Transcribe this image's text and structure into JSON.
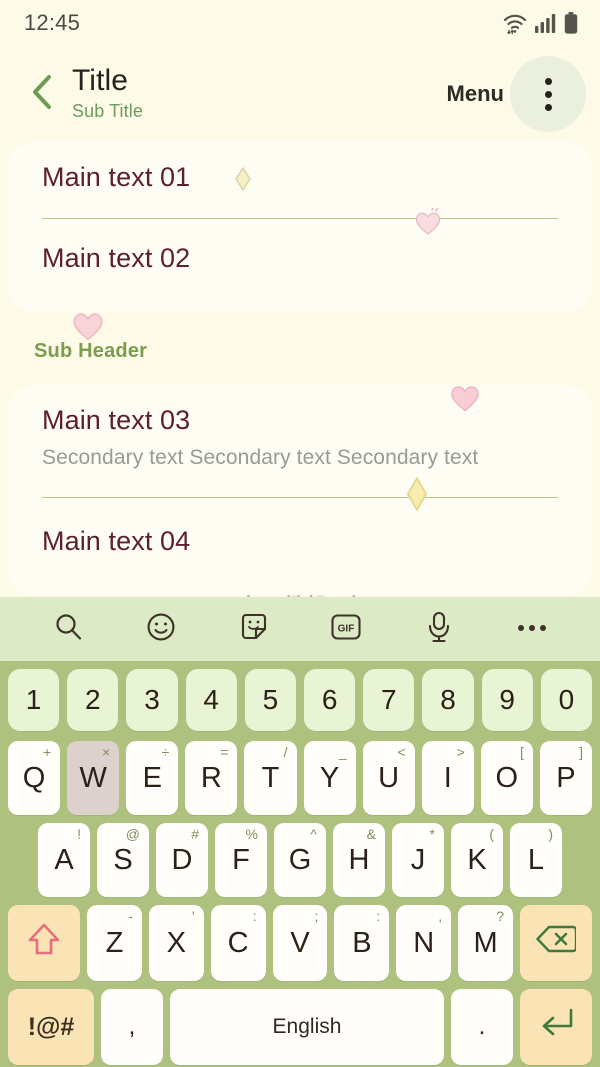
{
  "status_bar": {
    "time": "12:45",
    "icons": [
      "wifi-icon",
      "cellular-signal-icon",
      "battery-icon"
    ]
  },
  "app_bar": {
    "back_icon": "chevron-left-icon",
    "title": "Title",
    "subtitle": "Sub Title",
    "menu_label": "Menu",
    "overflow_icon": "more-vertical-icon"
  },
  "content": {
    "items": [
      {
        "main": "Main text 01",
        "secondary": ""
      },
      {
        "main": "Main text 02",
        "secondary": ""
      }
    ],
    "sub_header": "Sub Header",
    "items2": [
      {
        "main": "Main text 03",
        "secondary": "Secondary text Secondary text Secondary text"
      },
      {
        "main": "Main text 04",
        "secondary": ""
      }
    ],
    "decorations": [
      "diamond-sparkle-icon",
      "heart-icon",
      "heart-icon",
      "heart-icon",
      "diamond-sparkle-icon",
      "turnip-cat-illustration"
    ]
  },
  "keyboard": {
    "toolbar": [
      {
        "name": "search-icon",
        "label": ""
      },
      {
        "name": "emoji-icon",
        "label": ""
      },
      {
        "name": "sticker-icon",
        "label": ""
      },
      {
        "name": "gif-icon",
        "label": "GIF"
      },
      {
        "name": "microphone-icon",
        "label": ""
      },
      {
        "name": "more-horizontal-icon",
        "label": ""
      }
    ],
    "number_row": [
      "1",
      "2",
      "3",
      "4",
      "5",
      "6",
      "7",
      "8",
      "9",
      "0"
    ],
    "row_q": [
      {
        "key": "Q",
        "sup": "+"
      },
      {
        "key": "W",
        "sup": "×",
        "pressed": true
      },
      {
        "key": "E",
        "sup": "÷"
      },
      {
        "key": "R",
        "sup": "="
      },
      {
        "key": "T",
        "sup": "/"
      },
      {
        "key": "Y",
        "sup": "_"
      },
      {
        "key": "U",
        "sup": "<"
      },
      {
        "key": "I",
        "sup": ">"
      },
      {
        "key": "O",
        "sup": "["
      },
      {
        "key": "P",
        "sup": "]"
      }
    ],
    "row_a": [
      {
        "key": "A",
        "sup": "!"
      },
      {
        "key": "S",
        "sup": "@"
      },
      {
        "key": "D",
        "sup": "#"
      },
      {
        "key": "F",
        "sup": "%"
      },
      {
        "key": "G",
        "sup": "^"
      },
      {
        "key": "H",
        "sup": "&"
      },
      {
        "key": "J",
        "sup": "*"
      },
      {
        "key": "K",
        "sup": "("
      },
      {
        "key": "L",
        "sup": ")"
      }
    ],
    "row_z": [
      {
        "key": "Z",
        "sup": "-"
      },
      {
        "key": "X",
        "sup": "'"
      },
      {
        "key": "C",
        "sup": ":"
      },
      {
        "key": "V",
        "sup": ";"
      },
      {
        "key": "B",
        "sup": ":"
      },
      {
        "key": "N",
        "sup": ","
      },
      {
        "key": "M",
        "sup": "?"
      }
    ],
    "shift_icon": "shift-arrow-up-icon",
    "backspace_icon": "backspace-delete-icon",
    "symbols_label": "!@#",
    "comma_label": ",",
    "space_label": "English",
    "period_label": ".",
    "enter_icon": "enter-return-icon"
  },
  "colors": {
    "page_bg": "#fdfbe8",
    "card_bg": "#fefdf4",
    "accent_green": "#7b9e4e",
    "sub_title_green": "#6d9b5e",
    "main_text": "#5c1f2c",
    "secondary_text": "#9a9a94",
    "divider": "#b2c78a",
    "keyboard_bg": "#aec17e",
    "toolbar_bg": "#dcebc5",
    "key_bg": "#fffefa",
    "number_key_bg": "#e8f4d3",
    "func_key_bg": "#fae3b5",
    "pressed_key_bg": "#ddd1cd",
    "heart_pink": "#f6c7d0",
    "sparkle_yellow": "#f5ecb4"
  }
}
